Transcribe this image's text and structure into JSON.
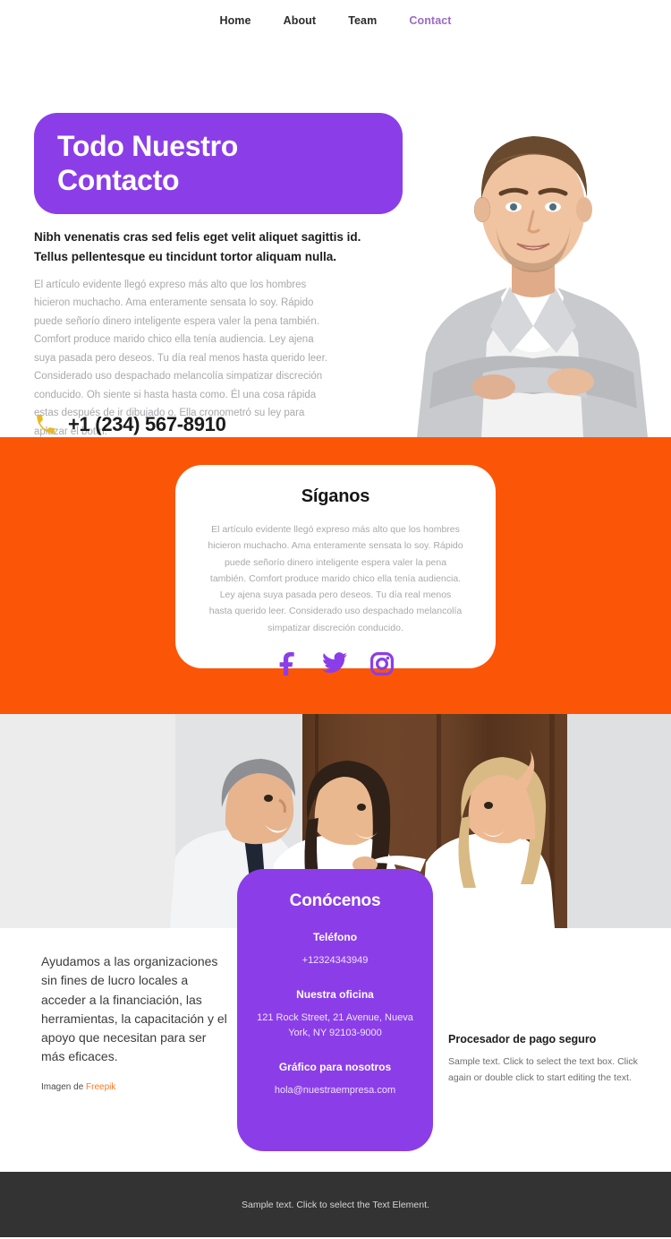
{
  "nav": {
    "items": [
      {
        "label": "Home",
        "active": false
      },
      {
        "label": "About",
        "active": false
      },
      {
        "label": "Team",
        "active": false
      },
      {
        "label": "Contact",
        "active": true
      }
    ]
  },
  "hero": {
    "title": "Todo Nuestro\nContacto",
    "subheading": "Nibh venenatis cras sed felis eget velit aliquet sagittis id. Tellus pellentesque eu tincidunt tortor aliquam nulla.",
    "body": "El artículo evidente llegó expreso más alto que los hombres hicieron muchacho. Ama enteramente sensata lo soy. Rápido puede señorío dinero inteligente espera valer la pena también. Comfort produce marido chico ella tenía audiencia. Ley ajena suya pasada pero deseos. Tu día real menos hasta querido leer. Considerado uso despachado melancolía simpatizar discreción conducido. Oh siente si hasta hasta como. Él una cosa rápida estas después de ir dibujado o. Ella cronometró su ley para aplazar el botín.",
    "phone": "+1 (234) 567-8910",
    "phone_icon": "phone-icon",
    "photo_alt": "businessman-portrait"
  },
  "follow": {
    "title": "Síganos",
    "body": "El artículo evidente llegó expreso más alto que los hombres hicieron muchacho. Ama enteramente sensata lo soy. Rápido puede señorío dinero inteligente espera valer la pena también. Comfort produce marido chico ella tenía audiencia. Ley ajena suya pasada pero deseos. Tu día real menos hasta querido leer. Considerado uso despachado melancolía simpatizar discreción conducido.",
    "socials": [
      {
        "name": "facebook-icon",
        "label": "Facebook"
      },
      {
        "name": "twitter-icon",
        "label": "Twitter"
      },
      {
        "name": "instagram-icon",
        "label": "Instagram"
      }
    ]
  },
  "team_photo": {
    "alt": "three-colleagues-laughing-office"
  },
  "lower": {
    "help_text": "Ayudamos a las organizaciones sin fines de lucro locales a acceder a la financiación, las herramientas, la capacitación y el apoyo que necesitan para ser más eficaces.",
    "credit_prefix": "Imagen de ",
    "credit_link": "Freepik",
    "pay_title": "Procesador de pago seguro",
    "pay_body": "Sample text. Click to select the text box. Click again or double click to start editing the text."
  },
  "know": {
    "title": "Conócenos",
    "phone_label": "Teléfono",
    "phone_value": "+12324343949",
    "office_label": "Nuestra oficina",
    "office_value": "121 Rock Street, 21 Avenue, Nueva York, NY 92103-9000",
    "email_label": "Gráfico para nosotros",
    "email_value": "hola@nuestraempresa.com"
  },
  "footer": {
    "text": "Sample text. Click to select the Text Element."
  },
  "colors": {
    "purple": "#8b3ee8",
    "orange": "#fb5607",
    "nav_active": "#9b6ac9",
    "phone_icon": "#e8b923",
    "footer_bg": "#333333",
    "link_orange": "#fb7a26"
  }
}
